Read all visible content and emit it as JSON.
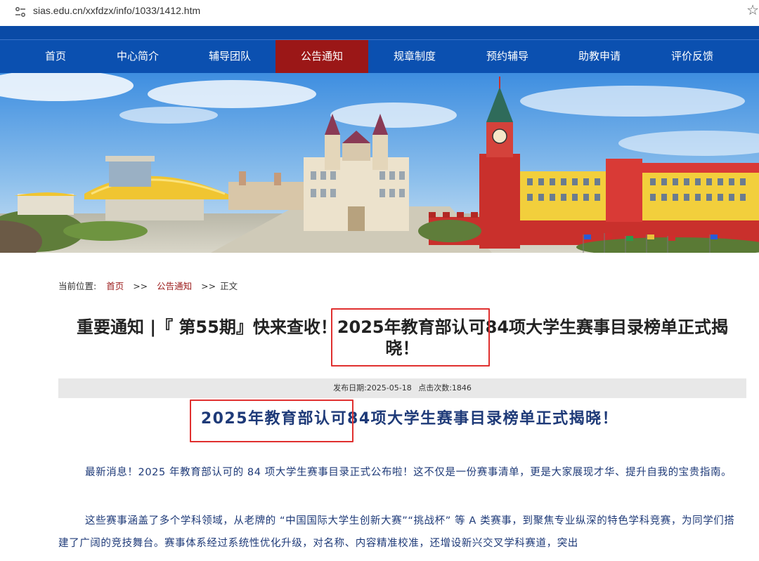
{
  "browser": {
    "url": "sias.edu.cn/xxfdzx/info/1033/1412.htm"
  },
  "nav": {
    "items": [
      {
        "label": "首页"
      },
      {
        "label": "中心简介"
      },
      {
        "label": "辅导团队"
      },
      {
        "label": "公告通知",
        "active": true
      },
      {
        "label": "规章制度"
      },
      {
        "label": "预约辅导"
      },
      {
        "label": "助教申请"
      },
      {
        "label": "评价反馈"
      }
    ]
  },
  "breadcrumb": {
    "prefix": "当前位置:",
    "home": "首页",
    "sep1": ">>",
    "section": "公告通知",
    "sep2": ">>",
    "current": "正文"
  },
  "article": {
    "title": "重要通知 |『 第55期』快来查收！2025年教育部认可84项大学生赛事目录榜单正式揭晓！",
    "publish_date": "发布日期:2025-05-18",
    "hits": "点击次数:1846",
    "heading": "2025年教育部认可84项大学生赛事目录榜单正式揭晓！",
    "paragraphs": [
      "最新消息！2025 年教育部认可的 84 项大学生赛事目录正式公布啦！这不仅是一份赛事清单，更是大家展现才华、提升自我的宝贵指南。",
      "这些赛事涵盖了多个学科领域，从老牌的 “中国国际大学生创新大赛”“挑战杯” 等 A 类赛事，到聚焦专业纵深的特色学科竞赛，为同学们搭建了广阔的竞技舞台。赛事体系经过系统性优化升级，对名称、内容精准校准，还增设新兴交叉学科赛道，突出"
    ]
  },
  "colors": {
    "nav_bg": "#0b50b0",
    "nav_active": "#9b1717",
    "highlight": "#e0302f",
    "body_text": "#1e3a78"
  }
}
